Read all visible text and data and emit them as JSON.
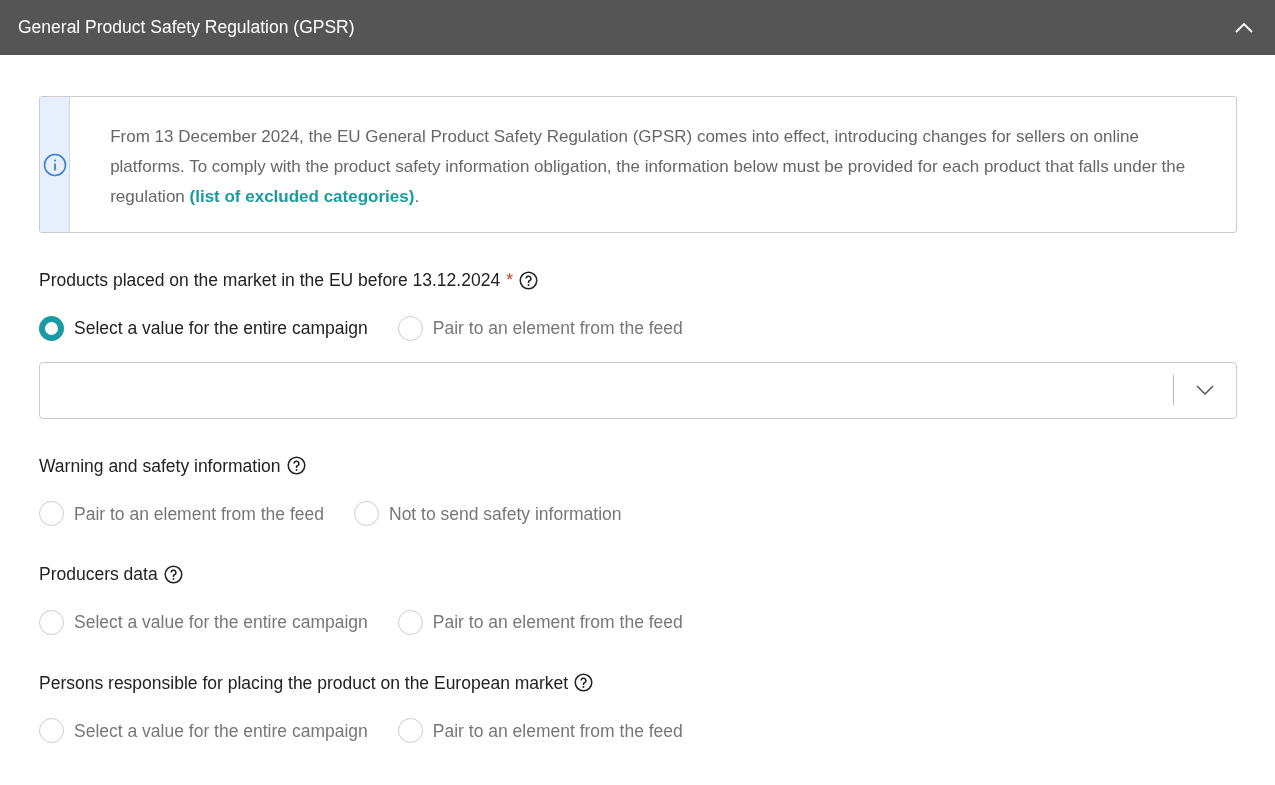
{
  "panel": {
    "title": "General Product Safety Regulation (GPSR)",
    "expanded": true
  },
  "notice": {
    "text": "From 13 December 2024, the EU General Product Safety Regulation (GPSR) comes into effect, introducing changes for sellers on online platforms. To comply with the product safety information obligation, the information below must be provided for each product that falls under the regulation ",
    "link": "(list of excluded categories)",
    "text_end": "."
  },
  "sections": [
    {
      "label": "Products placed on the market in the EU before 13.12.2024",
      "required_marker": "*",
      "options": [
        {
          "label": "Select a value for the entire campaign",
          "selected": true
        },
        {
          "label": "Pair to an element from the feed",
          "selected": false
        }
      ],
      "field": {
        "kind": "select"
      }
    },
    {
      "label": "Warning and safety information",
      "options": [
        {
          "label": "Pair to an element from the feed",
          "selected": false
        },
        {
          "label": "Not to send safety information",
          "selected": false
        }
      ]
    },
    {
      "label": "Producers data",
      "options": [
        {
          "label": "Select a value for the entire campaign",
          "selected": false
        },
        {
          "label": "Pair to an element from the feed",
          "selected": false
        }
      ]
    },
    {
      "label": "Persons responsible for placing the product on the European market",
      "options": [
        {
          "label": "Select a value for the entire campaign",
          "selected": false
        },
        {
          "label": "Pair to an element from the feed",
          "selected": false
        }
      ]
    }
  ]
}
